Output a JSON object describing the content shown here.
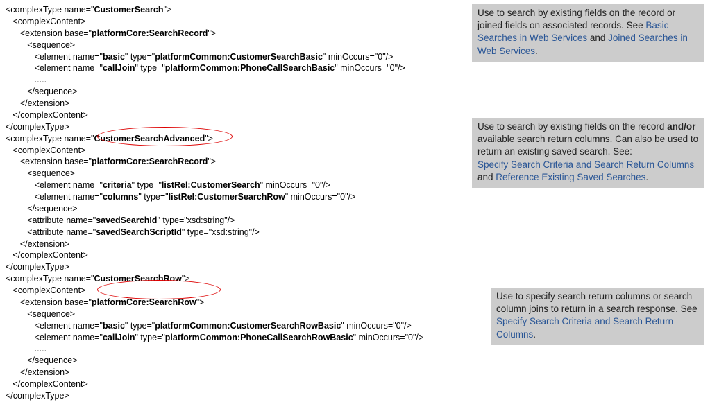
{
  "code": {
    "ct1_open_prefix": "<complexType name=\"",
    "ct1_name": "CustomerSearch",
    "ct1_open_suffix": "\">",
    "cc_open": "   <complexContent>",
    "ext1_prefix": "      <extension base=\"",
    "ext1_base": "platformCore:SearchRecord",
    "ext1_suffix": "\">",
    "seq_open": "         <sequence>",
    "el1_a": "            <element name=\"",
    "el1_name": "basic",
    "el1_b": "\" type=\"",
    "el1_type": "platformCommon:CustomerSearchBasic",
    "el1_c": "\" minOccurs=\"0\"/>",
    "el2_a": "            <element name=\"",
    "el2_name": "callJoin",
    "el2_b": "\" type=\"",
    "el2_type": "platformCommon:PhoneCallSearchBasic",
    "el2_c": "\" minOccurs=\"0\"/>",
    "dots": "            .....",
    "seq_close": "         </sequence>",
    "ext_close": "      </extension>",
    "cc_close": "   </complexContent>",
    "ct_close": "</complexType>",
    "ct2_name": "CustomerSearchAdvanced",
    "el3_name": "criteria",
    "el3_type": "listRel:CustomerSearch",
    "el4_name": "columns",
    "el4_type": "listRel:CustomerSearchRow",
    "attr1_a": "         <attribute name=\"",
    "attr1_name": "savedSearchId",
    "attr1_b": "\" type=\"xsd:string\"/>",
    "attr2_name": "savedSearchScriptId",
    "ct3_name": "CustomerSearchRow",
    "ext3_base": "platformCore:SearchRow",
    "el5_type": "platformCommon:CustomerSearchRowBasic",
    "el6_type": "platformCommon:PhoneCallSearchRowBasic",
    "dots2": "            ....."
  },
  "callouts": {
    "c1_t1": "Use to search by existing fields on the record or joined fields on associated records. See ",
    "c1_l1": "Basic Searches in Web Services",
    "c1_t2": " and ",
    "c1_l2": "Joined Searches in Web Services",
    "c1_t3": ".",
    "c2_t1": "Use to search by existing fields on the record ",
    "c2_b": "and/or",
    "c2_t2": " available search return columns. Can also be used to return an existing saved search. See:",
    "c2_l1": "Specify Search Criteria and Search Return Columns",
    "c2_t3": " and ",
    "c2_l2": "Reference Existing Saved Searches",
    "c2_t4": ".",
    "c3_t1": "Use to specify search return columns or search column joins to return in a search response. See ",
    "c3_l1": "Specify Search Criteria and Search Return Columns",
    "c3_t2": "."
  }
}
